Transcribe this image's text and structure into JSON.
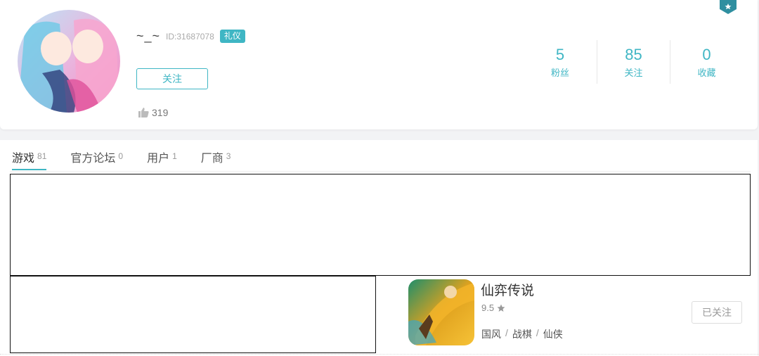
{
  "profile": {
    "username": "~_~",
    "user_id": "ID:31687078",
    "badge": "礼仪",
    "follow_label": "关注",
    "likes": "319"
  },
  "stats": [
    {
      "value": "5",
      "label": "粉丝"
    },
    {
      "value": "85",
      "label": "关注"
    },
    {
      "value": "0",
      "label": "收藏"
    }
  ],
  "tabs": [
    {
      "label": "游戏",
      "count": "81",
      "active": true
    },
    {
      "label": "官方论坛",
      "count": "0"
    },
    {
      "label": "用户",
      "count": "1"
    },
    {
      "label": "厂商",
      "count": "3"
    }
  ],
  "game": {
    "title": "仙弈传说",
    "rating": "9.5",
    "tags": [
      "国风",
      "战棋",
      "仙侠"
    ],
    "tag_separator": "/",
    "followed_label": "已关注"
  },
  "colors": {
    "accent": "#3fb6c4",
    "corner_badge": "#2f8fa0"
  },
  "icons": {
    "likes": "thumbs-up-icon",
    "rating": "star-icon",
    "corner": "shield-badge-icon"
  }
}
